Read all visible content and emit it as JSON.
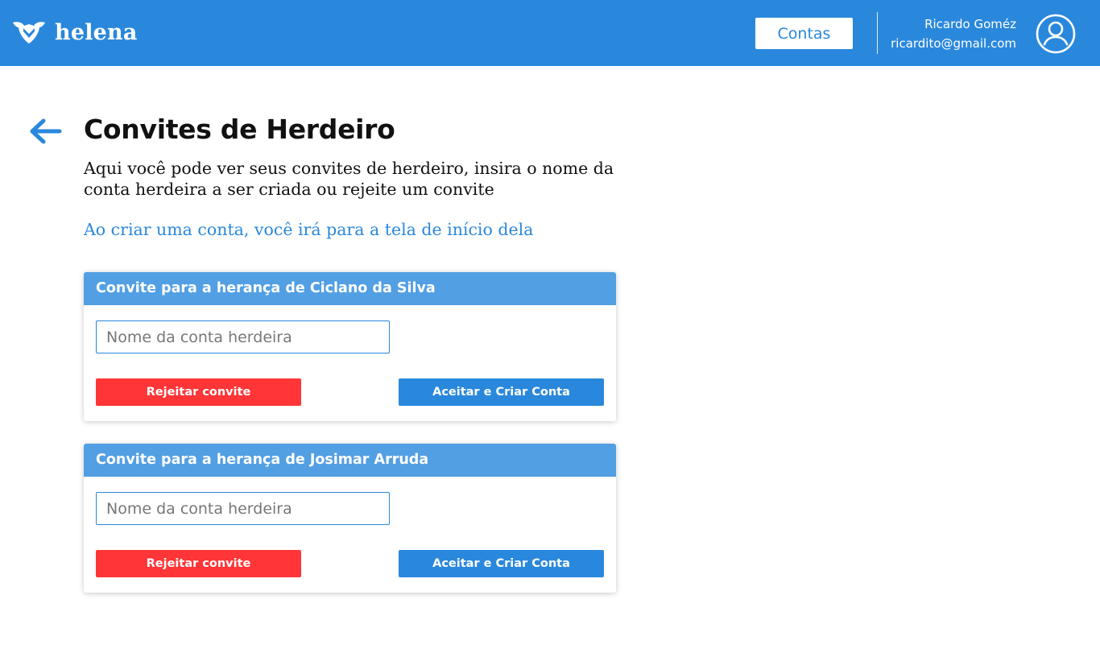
{
  "app": {
    "brand_name": "helena",
    "brand_color": "#2a88dc"
  },
  "header": {
    "accounts_button_label": "Contas",
    "user_name": "Ricardo Goméz",
    "user_email": "ricardito@gmail.com",
    "logo_icon": "shield-wings-icon",
    "avatar_icon": "user-circle-icon"
  },
  "page": {
    "back_icon": "arrow-left-icon",
    "title": "Convites de Herdeiro",
    "description": "Aqui você pode ver seus convites de herdeiro, insira o nome da conta herdeira a ser criada ou rejeite um convite",
    "note": "Ao criar uma conta, você irá para a tela de início dela"
  },
  "invites": [
    {
      "title": "Convite para a herança de Ciclano da Silva",
      "input_placeholder": "Nome da conta herdeira",
      "input_value": "",
      "reject_label": "Rejeitar convite",
      "accept_label": "Aceitar e Criar Conta"
    },
    {
      "title": "Convite para a herança de Josimar Arruda",
      "input_placeholder": "Nome da conta herdeira",
      "input_value": "",
      "reject_label": "Rejeitar convite",
      "accept_label": "Aceitar e Criar Conta"
    }
  ],
  "colors": {
    "header_bg": "#2a88dc",
    "card_header_bg": "#529fe3",
    "reject": "#ff3537",
    "accept": "#2a88dc"
  }
}
